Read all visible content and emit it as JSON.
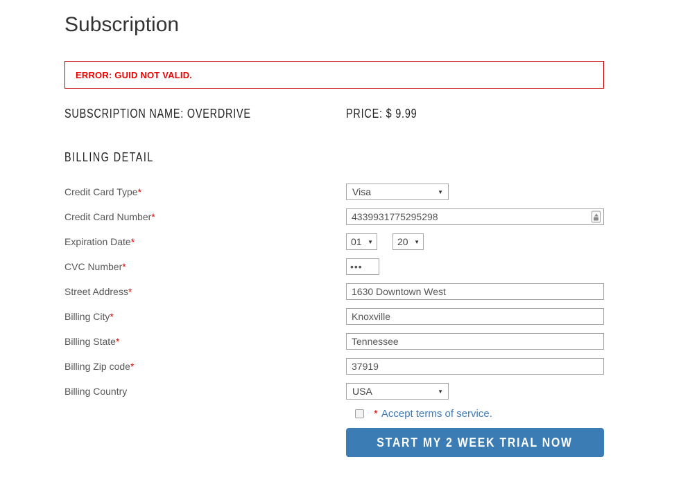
{
  "page": {
    "title": "Subscription"
  },
  "error": {
    "message": "ERROR: GUID NOT VALID."
  },
  "summary": {
    "subscription_name": "SUBSCRIPTION NAME: OVERDRIVE",
    "price": "PRICE: $ 9.99"
  },
  "billing": {
    "heading": "BILLING DETAIL",
    "required_marker": "*",
    "fields": [
      {
        "label": "Credit Card Type",
        "required": true,
        "type": "select",
        "value": "Visa"
      },
      {
        "label": "Credit Card Number",
        "required": true,
        "type": "text",
        "value": "4339931775295298"
      },
      {
        "label": "Expiration Date",
        "required": true,
        "type": "select-pair",
        "month": "01",
        "year": "20"
      },
      {
        "label": "CVC Number",
        "required": true,
        "type": "password",
        "value": "•••"
      },
      {
        "label": "Street Address",
        "required": true,
        "type": "text",
        "value": "1630 Downtown West"
      },
      {
        "label": "Billing City",
        "required": true,
        "type": "text",
        "value": "Knoxville"
      },
      {
        "label": "Billing State",
        "required": true,
        "type": "text",
        "value": "Tennessee"
      },
      {
        "label": "Billing Zip code",
        "required": true,
        "type": "text",
        "value": "37919"
      },
      {
        "label": "Billing Country",
        "required": false,
        "type": "select",
        "value": "USA"
      }
    ],
    "terms": {
      "marker": "*",
      "link": "Accept terms of service."
    },
    "submit_label": "START MY 2 WEEK TRIAL NOW"
  },
  "icons": {
    "chevron_down": "▼"
  },
  "colors": {
    "accent_blue": "#3b7cb5",
    "error_red": "#ee0000",
    "link_blue": "#3a7abd"
  }
}
